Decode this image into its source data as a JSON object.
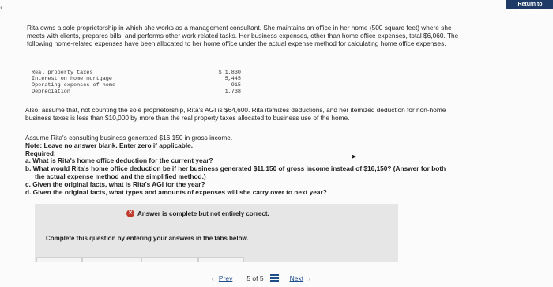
{
  "nav_top": {
    "return_label": "Return to question",
    "left_chevron": "‹"
  },
  "problem": {
    "intro": "Rita owns a sole proprietorship in which she works as a management consultant. She maintains an office in her home (500 square feet) where she meets with clients, prepares bills, and performs other work-related tasks. Her business expenses, other than home office expenses, total $6,060. The following home-related expenses have been allocated to her home office under the actual expense method for calculating home office expenses.",
    "costs": [
      {
        "label": "Real property taxes",
        "amount": "$ 1,830"
      },
      {
        "label": "Interest on home mortgage",
        "amount": "5,445"
      },
      {
        "label": "Operating expenses of home",
        "amount": "915"
      },
      {
        "label": "Depreciation",
        "amount": "1,738"
      }
    ],
    "assume": "Also, assume that, not counting the sole proprietorship, Rita's AGI is $64,600. Rita itemizes deductions, and her itemized deduction for non-home business taxes is less than $10,000 by more than the real property taxes allocated to business use of the home.",
    "gross_income": "Assume Rita's consulting business generated $16,150 in gross income.",
    "note": "Note: Leave no answer blank. Enter zero if applicable.",
    "required": "Required:",
    "questions": {
      "a": "a. What is Rita's home office deduction for the current year?",
      "b1": "b. What would Rita's home office deduction be if her business generated $11,150 of gross income instead of $16,150? (Answer for both",
      "b2": "the actual expense method and the simplified method.)",
      "c": "c. Given the original facts, what is Rita's AGI for the year?",
      "d": "d. Given the original facts, what types and amounts of expenses will she carry over to next year?"
    }
  },
  "answer_panel": {
    "status": "Answer is complete but not entirely correct.",
    "instruction": "Complete this question by entering your answers in the tabs below."
  },
  "pagination": {
    "prev": "Prev",
    "page": "5 of 5",
    "next": "Next"
  },
  "colors": {
    "return_bg": "#1e3a66",
    "error_red": "#c0392b",
    "link_blue": "#1f4e8c"
  }
}
